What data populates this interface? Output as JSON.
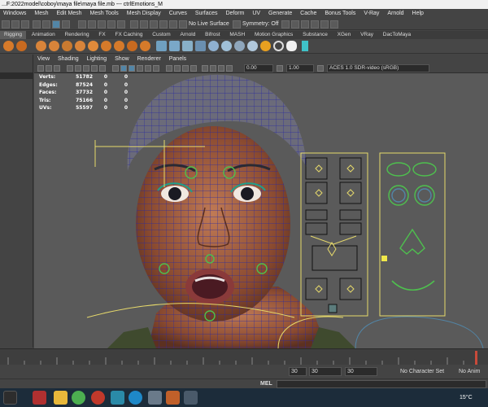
{
  "window": {
    "title": "...F:2022model\\coboy\\maya file\\maya file.mb  ---  ctrlEmotions_M"
  },
  "menubar": {
    "items": [
      "Windows",
      "Mesh",
      "Edit Mesh",
      "Mesh Tools",
      "Mesh Display",
      "Curves",
      "Surfaces",
      "Deform",
      "UV",
      "Generate",
      "Cache",
      "Bonus Tools",
      "V-Ray",
      "Arnold",
      "Help"
    ]
  },
  "statusline": {
    "live_surface": "No Live Surface",
    "symmetry": "Symmetry: Off"
  },
  "shelf": {
    "tabs": [
      "Rigging",
      "Animation",
      "Rendering",
      "FX",
      "FX Caching",
      "Custom",
      "Arnold",
      "Bifrost",
      "MASH",
      "Motion Graphics",
      "Substance",
      "XGen",
      "VRay",
      "DacToMaya"
    ],
    "active_tab": "Rigging"
  },
  "panel": {
    "menus": [
      "View",
      "Shading",
      "Lighting",
      "Show",
      "Renderer",
      "Panels"
    ],
    "near_value": "0.00",
    "far_value": "1.00",
    "color_space": "ACES 1.0 SDR-video (sRGB)"
  },
  "hud": {
    "rows": [
      {
        "label": "Verts:",
        "value": "51782",
        "v2": "0",
        "v3": "0"
      },
      {
        "label": "Edges:",
        "value": "87524",
        "v2": "0",
        "v3": "0"
      },
      {
        "label": "Faces:",
        "value": "37732",
        "v2": "0",
        "v3": "0"
      },
      {
        "label": "Tris:",
        "value": "75166",
        "v2": "0",
        "v3": "0"
      },
      {
        "label": "UVs:",
        "value": "55597",
        "v2": "0",
        "v3": "0"
      }
    ]
  },
  "range": {
    "start": "30",
    "end": "30",
    "current": "30",
    "character_set": "No Character Set",
    "anim_layer": "No Anim Layer"
  },
  "command_line": {
    "label": "MEL"
  },
  "taskbar": {
    "temperature": "15°C"
  },
  "colors": {
    "accent": "#5285a6",
    "wire": "#2a2aa0",
    "control": "#e6d96b",
    "viewport_bg": "#5a5a5a"
  }
}
